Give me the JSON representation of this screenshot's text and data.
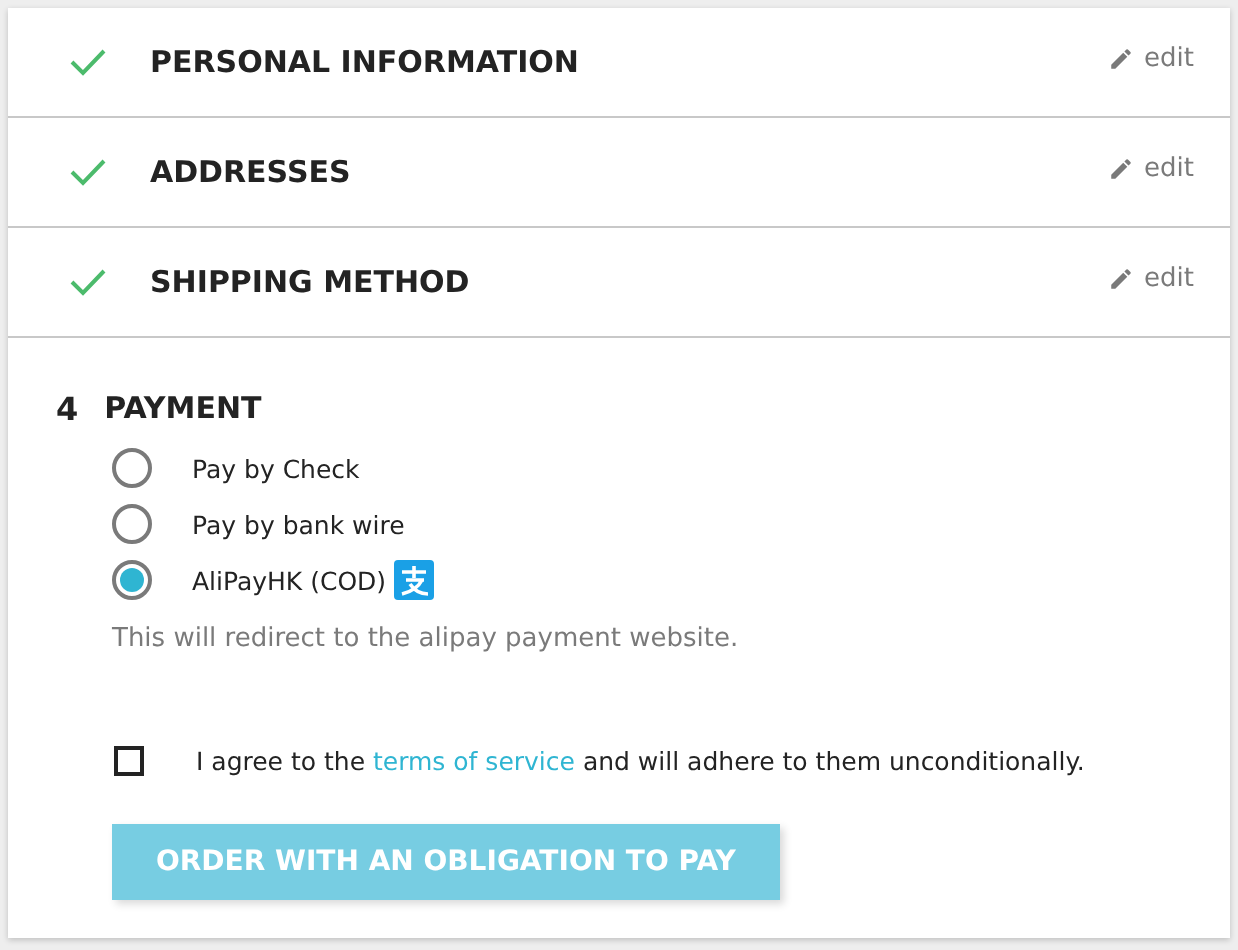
{
  "steps": [
    {
      "title": "PERSONAL INFORMATION",
      "complete": true,
      "edit": "edit"
    },
    {
      "title": "ADDRESSES",
      "complete": true,
      "edit": "edit"
    },
    {
      "title": "SHIPPING METHOD",
      "complete": true,
      "edit": "edit"
    }
  ],
  "payment": {
    "number": "4",
    "title": "PAYMENT",
    "options": [
      {
        "label": "Pay by Check",
        "selected": false,
        "logo": false
      },
      {
        "label": "Pay by bank wire",
        "selected": false,
        "logo": false
      },
      {
        "label": "AliPayHK (COD)",
        "selected": true,
        "logo": true
      }
    ],
    "note": "This will redirect to the alipay payment website.",
    "terms": {
      "checked": false,
      "before": "I agree to the ",
      "link": "terms of service",
      "after": " and will adhere to them unconditionally."
    },
    "button": {
      "label": "ORDER WITH AN OBLIGATION TO PAY",
      "disabled": true
    }
  }
}
